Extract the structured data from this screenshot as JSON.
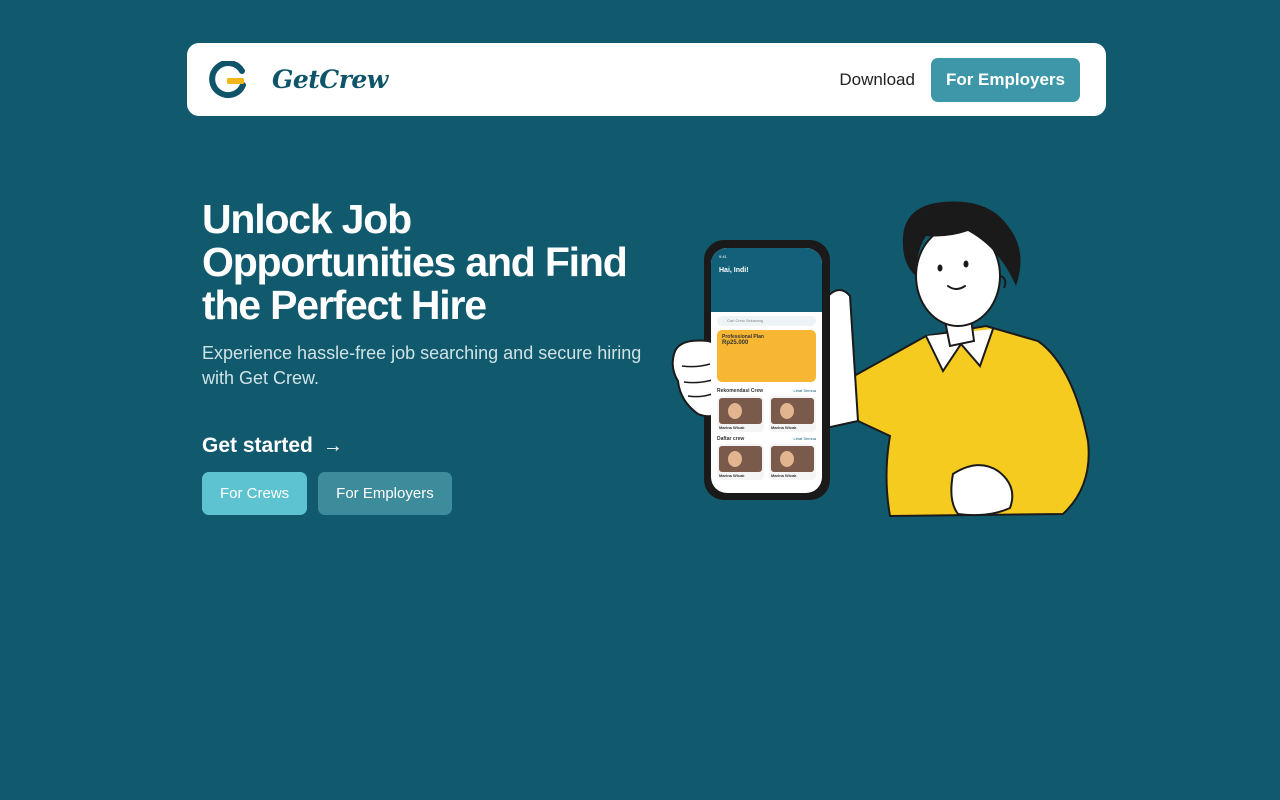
{
  "navbar": {
    "brand": "GetCrew",
    "download_label": "Download",
    "employers_label": "For Employers"
  },
  "hero": {
    "title": "Unlock Job Opportunities and Find the Perfect Hire",
    "subtitle": "Experience hassle-free job searching and secure hiring with Get Crew.",
    "get_started_label": "Get started",
    "arrow_icon": "arrow-right-icon",
    "crews_button": "For Crews",
    "employers_button": "For Employers"
  },
  "phone": {
    "greeting": "Hai, Indi!",
    "search_placeholder": "Cari Crew Sekarang",
    "promo_title": "Professional Plan",
    "promo_price": "Rp25.000",
    "section1": "Rekomendasi Crew",
    "section2": "Daftar crew",
    "see_all": "Lihat Semua",
    "card_name": "Marina Wicak"
  },
  "colors": {
    "background": "#115a6e",
    "accent": "#3e97a8",
    "crews_button": "#5ec3d0",
    "logo_yellow": "#f2b61c",
    "shirt_yellow": "#f6cb1f"
  }
}
